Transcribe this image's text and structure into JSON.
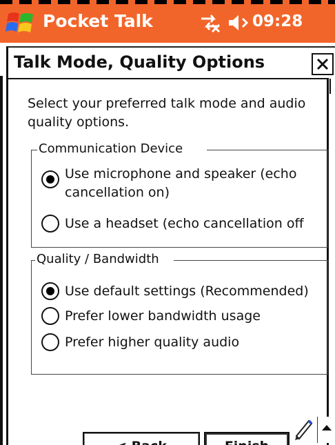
{
  "statusbar": {
    "app_name": "Pocket Talk",
    "time": "09:28",
    "icons": [
      "windows-start-icon",
      "sync-icon",
      "speaker-icon"
    ],
    "background_color": "#f2652a"
  },
  "dialog": {
    "title": "Talk Mode, Quality Options",
    "close_label": "×",
    "intro": "Select your preferred talk mode and audio quality options."
  },
  "communication_device": {
    "legend": "Communication Device",
    "options": [
      {
        "label": "Use microphone and speaker (echo cancellation on)",
        "checked": true
      },
      {
        "label": "Use a headset (echo cancellation off",
        "checked": false
      }
    ]
  },
  "quality_bandwidth": {
    "legend": "Quality / Bandwidth",
    "options": [
      {
        "label": "Use default settings (Recommended)",
        "checked": true
      },
      {
        "label": "Prefer lower bandwidth usage",
        "checked": false
      },
      {
        "label": "Prefer higher quality audio",
        "checked": false
      }
    ]
  },
  "footer": {
    "back_label": "< Back",
    "finish_label": "Finish",
    "input_icon": "pen-icon",
    "scroll_icon": "up-arrow-icon"
  }
}
